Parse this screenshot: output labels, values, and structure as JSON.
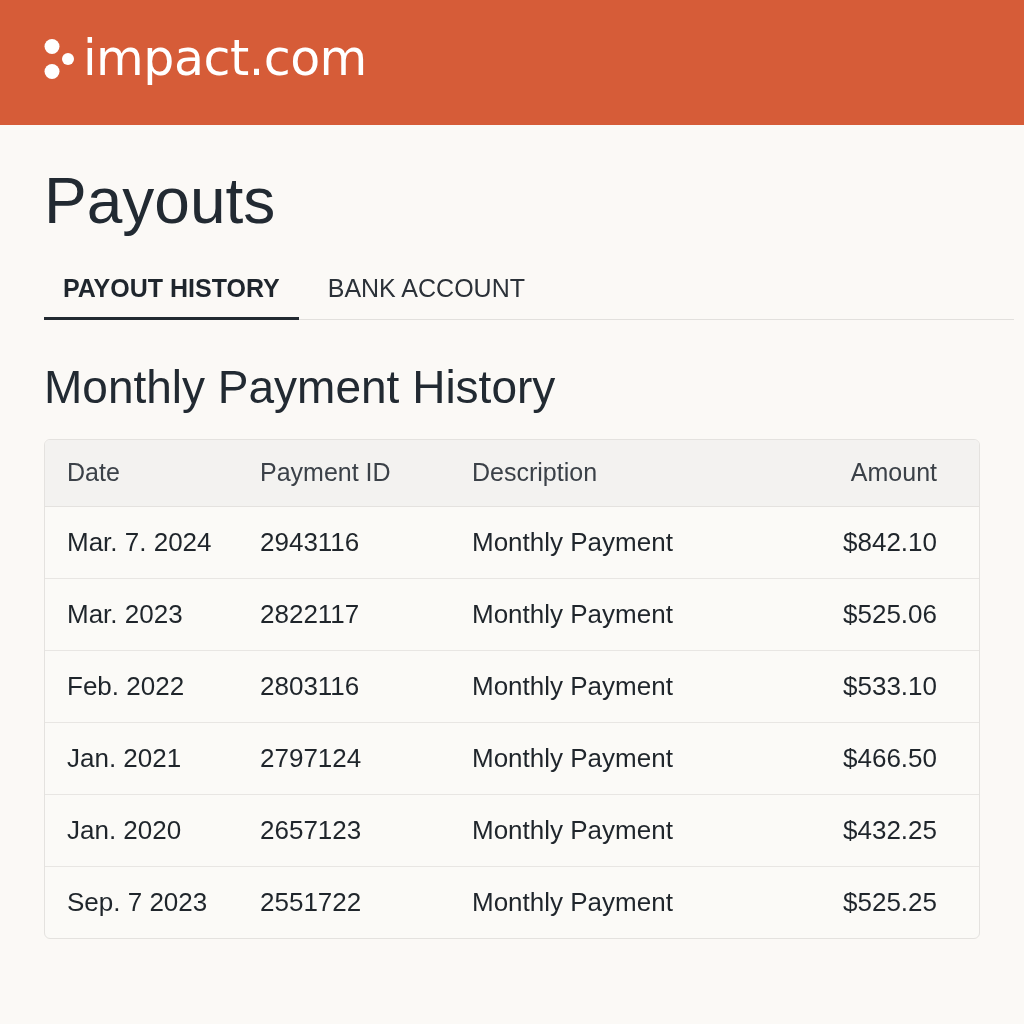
{
  "header": {
    "logo": "impact.com"
  },
  "page": {
    "title": "Payouts"
  },
  "tabs": [
    {
      "label": "PAYOUT HISTORY",
      "selected": true
    },
    {
      "label": "BANK ACCOUNT",
      "selected": false
    }
  ],
  "section": {
    "title": "Monthly Payment History"
  },
  "table": {
    "columns": [
      "Date",
      "Payment ID",
      "Description",
      "Amount"
    ],
    "rows": [
      [
        "Mar. 7. 2024",
        "2943116",
        "Monthly Payment",
        "$842.10"
      ],
      [
        "Mar. 2023",
        "2822117",
        "Monthly Payment",
        "$525.06"
      ],
      [
        "Feb. 2022",
        "2803116",
        "Monthly Payment",
        "$533.10"
      ],
      [
        "Jan. 2021",
        "2797124",
        "Monthly Payment",
        "$466.50"
      ],
      [
        "Jan. 2020",
        "2657123",
        "Monthly Payment",
        "$432.25"
      ],
      [
        "Sep. 7 2023",
        "2551722",
        "Monthly Payment",
        "$525.25"
      ]
    ]
  }
}
